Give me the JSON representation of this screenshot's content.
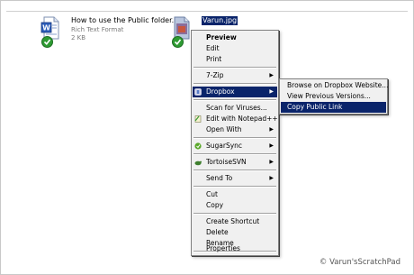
{
  "files": [
    {
      "name": "How to use the Public folder.rtf",
      "type": "Rich Text Format",
      "size": "2 KB",
      "icon": "word-document-icon"
    },
    {
      "name": "Varun.jpg",
      "icon": "jpeg-image-icon",
      "selected": true
    }
  ],
  "context_menu": {
    "items": [
      {
        "label": "Preview",
        "bold": true
      },
      {
        "label": "Edit"
      },
      {
        "label": "Print"
      },
      {
        "label": "7-Zip",
        "submenu": true
      },
      {
        "label": "Dropbox",
        "submenu": true,
        "highlighted": true,
        "icon": "dropbox-icon"
      },
      {
        "label": "Scan for Viruses..."
      },
      {
        "label": "Edit with Notepad++",
        "icon": "notepad-plus-icon"
      },
      {
        "label": "Open With",
        "submenu": true
      },
      {
        "label": "SugarSync",
        "submenu": true,
        "icon": "sugarsync-icon"
      },
      {
        "label": "TortoiseSVN",
        "submenu": true,
        "icon": "tortoisesvn-icon"
      },
      {
        "label": "Send To",
        "submenu": true
      },
      {
        "label": "Cut"
      },
      {
        "label": "Copy"
      },
      {
        "label": "Create Shortcut"
      },
      {
        "label": "Delete"
      },
      {
        "label": "Rename"
      },
      {
        "label": "Properties"
      }
    ]
  },
  "dropbox_submenu": {
    "items": [
      {
        "label": "Browse on Dropbox Website..."
      },
      {
        "label": "View Previous Versions..."
      },
      {
        "label": "Copy Public Link",
        "highlighted": true
      }
    ]
  },
  "watermark": "© Varun'sScratchPad",
  "colors": {
    "highlight": "#0a246a",
    "menu_bg": "#f0f0f0",
    "sync_check": "#2e9b32"
  }
}
